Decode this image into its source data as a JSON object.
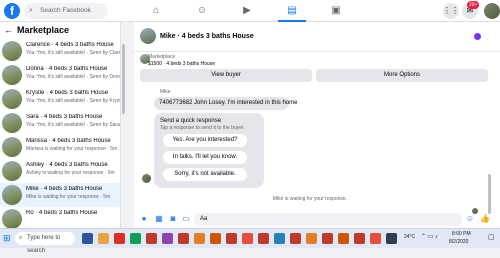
{
  "topbar": {
    "logo": "f",
    "search_placeholder": "Search Facebook",
    "notification_count": "20+"
  },
  "sidebar": {
    "title": "Marketplace",
    "items": [
      {
        "title": "Clarence · 4 beds 3 baths House",
        "sub": "You: Yes, it's still available! · Seen by Clarence · 2m"
      },
      {
        "title": "Donna · 4 beds 3 baths House",
        "sub": "You: Yes, it's still available! · Seen by Donna · 2m"
      },
      {
        "title": "Krystle · 4 beds 3 baths House",
        "sub": "You: Yes, it's still available! · Seen by Krystle · 2m"
      },
      {
        "title": "Sara · 4 beds 3 baths House",
        "sub": "You: Yes, it's still available! · Seen by Sara · 3m"
      },
      {
        "title": "Marissa · 4 beds 3 baths House",
        "sub": "Marissa is waiting for your response · 5m"
      },
      {
        "title": "Ashley · 4 beds 3 baths House",
        "sub": "Ashley is waiting for your response · 5m"
      },
      {
        "title": "Mike · 4 beds 3 baths House",
        "sub": "Mike is waiting for your response · 5m"
      },
      {
        "title": "Ro · 4 beds 3 baths House",
        "sub": ""
      }
    ]
  },
  "conversation": {
    "title": "Mike · 4 beds 3 baths House",
    "listing_label": "Marketplace",
    "listing_price": "$1500 · 4 beds 3 baths House",
    "view_buyer": "View buyer",
    "more_options": "More Options",
    "sender": "Mike",
    "message": "7406773682 John Losey. I'm interested in this home",
    "quick_title": "Send a quick response",
    "quick_sub": "Tap a response to send it to the buyer.",
    "quick_responses": [
      "Yes. Are you interested?",
      "In talks. I'll let you know.",
      "Sorry, it's not available."
    ],
    "typing_status": "Mike is waiting for your response.",
    "composer_value": "Aa"
  },
  "taskbar": {
    "search_placeholder": "Type here to search",
    "weather": "24°C",
    "time": "8:00 PM",
    "date": "8/2/2020"
  }
}
